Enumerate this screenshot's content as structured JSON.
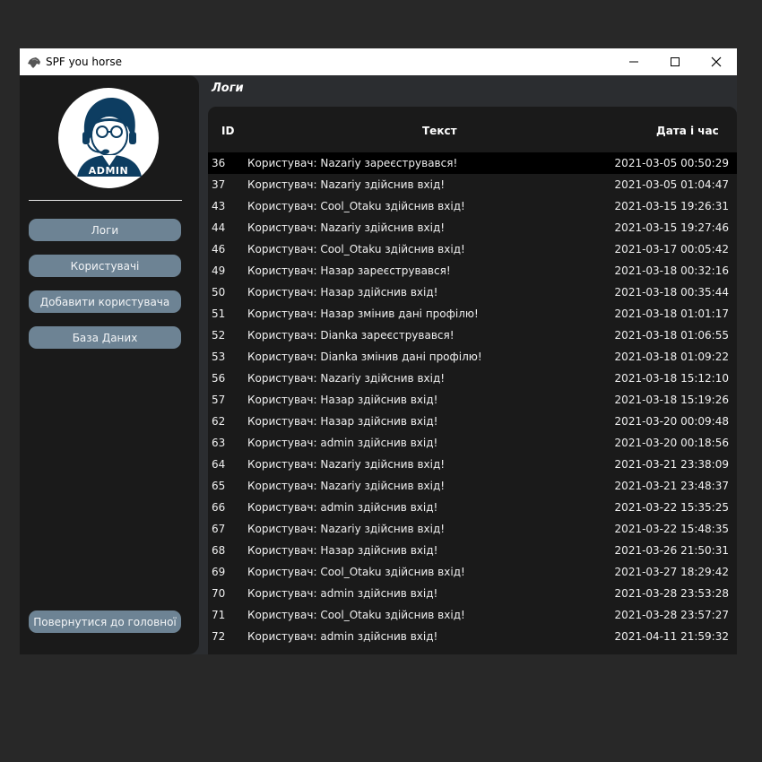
{
  "window": {
    "title": "SPF you horse"
  },
  "sidebar": {
    "avatar_label": "ADMIN",
    "nav": [
      {
        "label": "Логи"
      },
      {
        "label": "Користувачі"
      },
      {
        "label": "Добавити користувача"
      },
      {
        "label": "База Даних"
      }
    ],
    "back_label": "Повернутися до головної"
  },
  "main": {
    "title": "Логи",
    "columns": {
      "id": "ID",
      "text": "Текст",
      "date": "Дата і час"
    },
    "rows": [
      {
        "id": "36",
        "text": "Користувач: Nazariy зареєструвався!",
        "date": "2021-03-05 00:50:29"
      },
      {
        "id": "37",
        "text": "Користувач: Nazariy здійснив вхід!",
        "date": "2021-03-05 01:04:47"
      },
      {
        "id": "43",
        "text": "Користувач: Cool_Otaku здійснив вхід!",
        "date": "2021-03-15 19:26:31"
      },
      {
        "id": "44",
        "text": "Користувач: Nazariy здійснив вхід!",
        "date": "2021-03-15 19:27:46"
      },
      {
        "id": "46",
        "text": "Користувач: Cool_Otaku здійснив вхід!",
        "date": "2021-03-17 00:05:42"
      },
      {
        "id": "49",
        "text": "Користувач: Назар зареєструвався!",
        "date": "2021-03-18 00:32:16"
      },
      {
        "id": "50",
        "text": "Користувач: Назар здійснив вхід!",
        "date": "2021-03-18 00:35:44"
      },
      {
        "id": "51",
        "text": "Користувач: Назар змінив дані профілю!",
        "date": "2021-03-18 01:01:17"
      },
      {
        "id": "52",
        "text": "Користувач: Dianka зареєструвався!",
        "date": "2021-03-18 01:06:55"
      },
      {
        "id": "53",
        "text": "Користувач: Dianka змінив дані профілю!",
        "date": "2021-03-18 01:09:22"
      },
      {
        "id": "56",
        "text": "Користувач: Nazariy здійснив вхід!",
        "date": "2021-03-18 15:12:10"
      },
      {
        "id": "57",
        "text": "Користувач: Назар здійснив вхід!",
        "date": "2021-03-18 15:19:26"
      },
      {
        "id": "62",
        "text": "Користувач: Назар здійснив вхід!",
        "date": "2021-03-20 00:09:48"
      },
      {
        "id": "63",
        "text": "Користувач: admin здійснив вхід!",
        "date": "2021-03-20 00:18:56"
      },
      {
        "id": "64",
        "text": "Користувач: Nazariy здійснив вхід!",
        "date": "2021-03-21 23:38:09"
      },
      {
        "id": "65",
        "text": "Користувач: Nazariy здійснив вхід!",
        "date": "2021-03-21 23:48:37"
      },
      {
        "id": "66",
        "text": "Користувач: admin здійснив вхід!",
        "date": "2021-03-22 15:35:25"
      },
      {
        "id": "67",
        "text": "Користувач: Nazariy здійснив вхід!",
        "date": "2021-03-22 15:48:35"
      },
      {
        "id": "68",
        "text": "Користувач: Назар здійснив вхід!",
        "date": "2021-03-26 21:50:31"
      },
      {
        "id": "69",
        "text": "Користувач: Cool_Otaku здійснив вхід!",
        "date": "2021-03-27 18:29:42"
      },
      {
        "id": "70",
        "text": "Користувач: admin здійснив вхід!",
        "date": "2021-03-28 23:53:28"
      },
      {
        "id": "71",
        "text": "Користувач: Cool_Otaku здійснив вхід!",
        "date": "2021-03-28 23:57:27"
      },
      {
        "id": "72",
        "text": "Користувач: admin здійснив вхід!",
        "date": "2021-04-11 21:59:32"
      }
    ]
  },
  "colors": {
    "page_bg": "#282828",
    "window_bg": "#2b2d30",
    "panel_bg": "#1a1a1a",
    "nav_button": "#6d8394",
    "selected_row": "#000000",
    "avatar_brand": "#0d3d61"
  },
  "icons": {
    "app": "horse-icon",
    "minimize": "minimize-icon",
    "maximize": "maximize-icon",
    "close": "close-icon"
  }
}
